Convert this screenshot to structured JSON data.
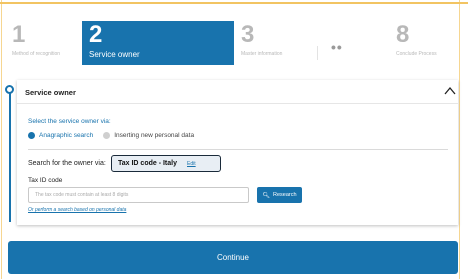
{
  "steps": [
    {
      "number": "1",
      "label": "Method of recognition",
      "active": false
    },
    {
      "number": "2",
      "label": "Service owner",
      "active": true
    },
    {
      "number": "3",
      "label": "Master information",
      "active": false
    },
    {
      "ellipsis": "••"
    },
    {
      "number": "8",
      "label": "Conclude Process",
      "active": false
    }
  ],
  "section": {
    "title": "Service owner",
    "collapse_icon": "chevron-up-icon"
  },
  "search_via": {
    "intro": "Select the service owner via:",
    "options": [
      {
        "label": "Anagraphic search",
        "selected": true
      },
      {
        "label": "Inserting new personal data",
        "selected": false
      }
    ]
  },
  "search_for": {
    "label": "Search for the owner via:",
    "chip_value": "Tax ID code - Italy",
    "edit_label": "Edit"
  },
  "tax_id": {
    "label": "Tax ID code",
    "value": "",
    "placeholder": "The tax code must contain at least 8 digits",
    "research_label": "Research",
    "research_icon": "search-icon"
  },
  "alt_link": "Or perform a search based on personal data",
  "footer": {
    "continue_label": "Continue"
  },
  "colors": {
    "accent": "#1873ad",
    "muted_step": "#b8b8b8"
  }
}
